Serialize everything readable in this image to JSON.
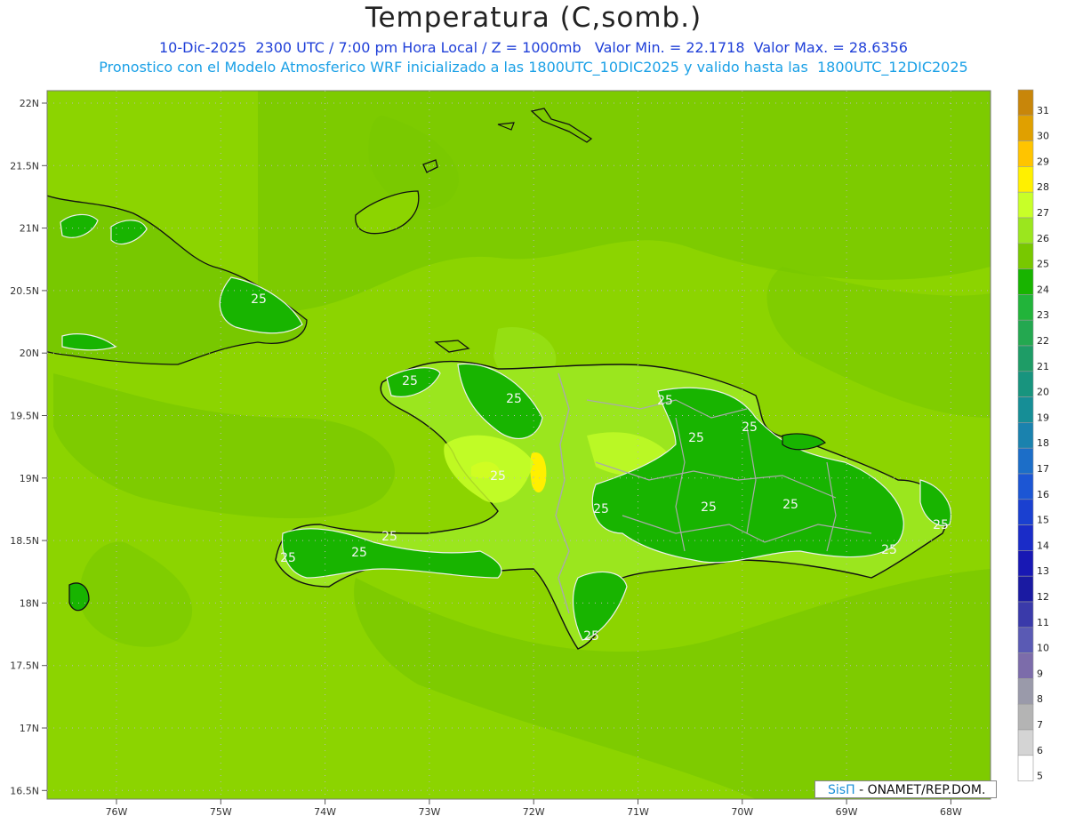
{
  "header": {
    "title": "Temperatura (C,somb.)",
    "line1": "10-Dic-2025  2300 UTC / 7:00 pm Hora Local / Z = 1000mb   Valor Min. = 22.1718  Valor Max. = 28.6356",
    "line2": "Pronostico con el Modelo Atmosferico WRF inicializado a las 1800UTC_10DIC2025 y valido hasta las  1800UTC_12DIC2025"
  },
  "map": {
    "lat_labels": [
      "22N",
      "21.5N",
      "21N",
      "20.5N",
      "20N",
      "19.5N",
      "19N",
      "18.5N",
      "18N",
      "17.5N",
      "17N",
      "16.5N"
    ],
    "lon_labels": [
      "76W",
      "75W",
      "74W",
      "73W",
      "72W",
      "71W",
      "70W",
      "69W",
      "68W"
    ],
    "contour_labels": [
      "25",
      "25",
      "25",
      "25",
      "25",
      "25",
      "25",
      "25",
      "25",
      "25",
      "25",
      "25",
      "25",
      "25",
      "25",
      "25"
    ]
  },
  "legend": {
    "levels": [
      "31",
      "30",
      "29",
      "28",
      "27",
      "26",
      "25",
      "24",
      "23",
      "22",
      "21",
      "20",
      "19",
      "18",
      "17",
      "16",
      "15",
      "14",
      "13",
      "12",
      "11",
      "10",
      "9",
      "8",
      "7",
      "6",
      "5"
    ],
    "colors": [
      "#c8860a",
      "#e0a000",
      "#ffc400",
      "#fff000",
      "#c8ff28",
      "#9be61e",
      "#78c800",
      "#18b400",
      "#22b43a",
      "#24a850",
      "#1e9c66",
      "#18947e",
      "#168e96",
      "#1a82ae",
      "#1c6ec8",
      "#1c56d4",
      "#1a40d0",
      "#1a2cc8",
      "#1818b4",
      "#1a1aa2",
      "#3a3aaa",
      "#5a5ab4",
      "#7c6caa",
      "#9a9aaa",
      "#b4b4b4",
      "#d4d4d4",
      "#ffffff"
    ]
  },
  "credit": {
    "brand": "SisΠ",
    "text": "- ONAMET/REP.DOM."
  }
}
